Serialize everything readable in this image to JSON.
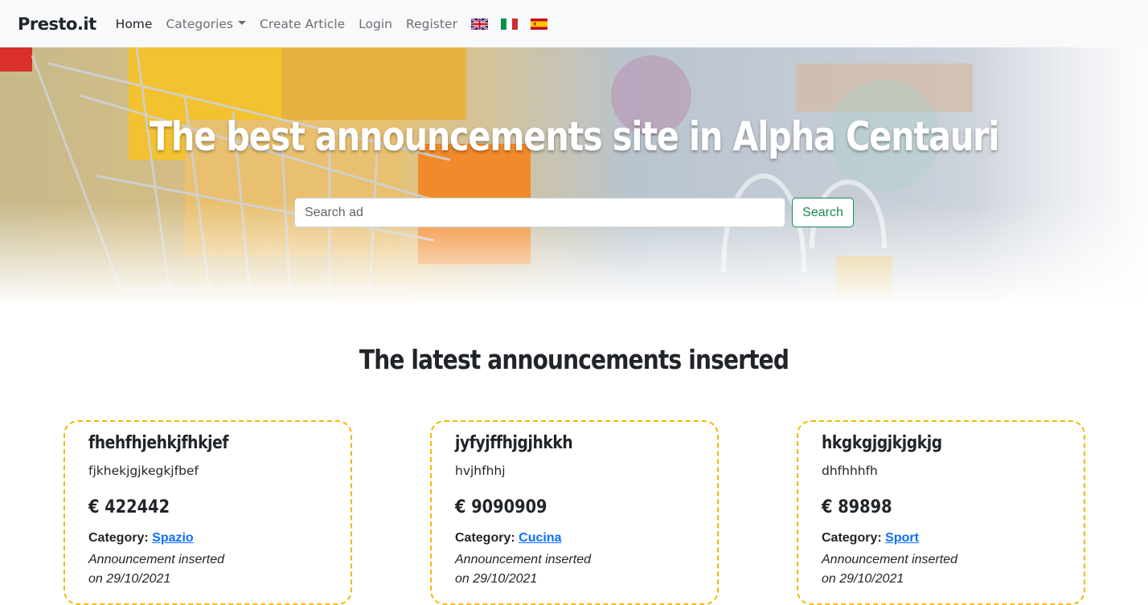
{
  "navbar": {
    "brand": "Presto.it",
    "links": {
      "home": "Home",
      "categories": "Categories",
      "create_article": "Create Article",
      "login": "Login",
      "register": "Register"
    },
    "flags": [
      "uk-flag-icon",
      "italy-flag-icon",
      "spain-flag-icon"
    ]
  },
  "hero": {
    "title": "The best announcements site in Alpha Centauri",
    "search_placeholder": "Search ad",
    "search_button": "Search"
  },
  "section": {
    "title": "The latest announcements inserted"
  },
  "cards": [
    {
      "title": "fhehfhjehkjfhkjef",
      "description": "fjkhekjgjkegkjfbef",
      "price": "€ 422442",
      "category_label": "Category:",
      "category": "Spazio",
      "inserted_line1": "Announcement inserted",
      "inserted_line2": "on 29/10/2021"
    },
    {
      "title": "jyfyjffhjgjhkkh",
      "description": "hvjhfhhj",
      "price": "€ 9090909",
      "category_label": "Category:",
      "category": "Cucina",
      "inserted_line1": "Announcement inserted",
      "inserted_line2": "on 29/10/2021"
    },
    {
      "title": "hkgkgjgjkjgkjg",
      "description": "dhfhhhfh",
      "price": "€ 89898",
      "category_label": "Category:",
      "category": "Sport",
      "inserted_line1": "Announcement inserted",
      "inserted_line2": "on 29/10/2021"
    }
  ],
  "colors": {
    "navbar_bg": "#f8f9fa",
    "accent_green": "#198754",
    "card_border": "#f5b800",
    "link_blue": "#0d6efd"
  }
}
